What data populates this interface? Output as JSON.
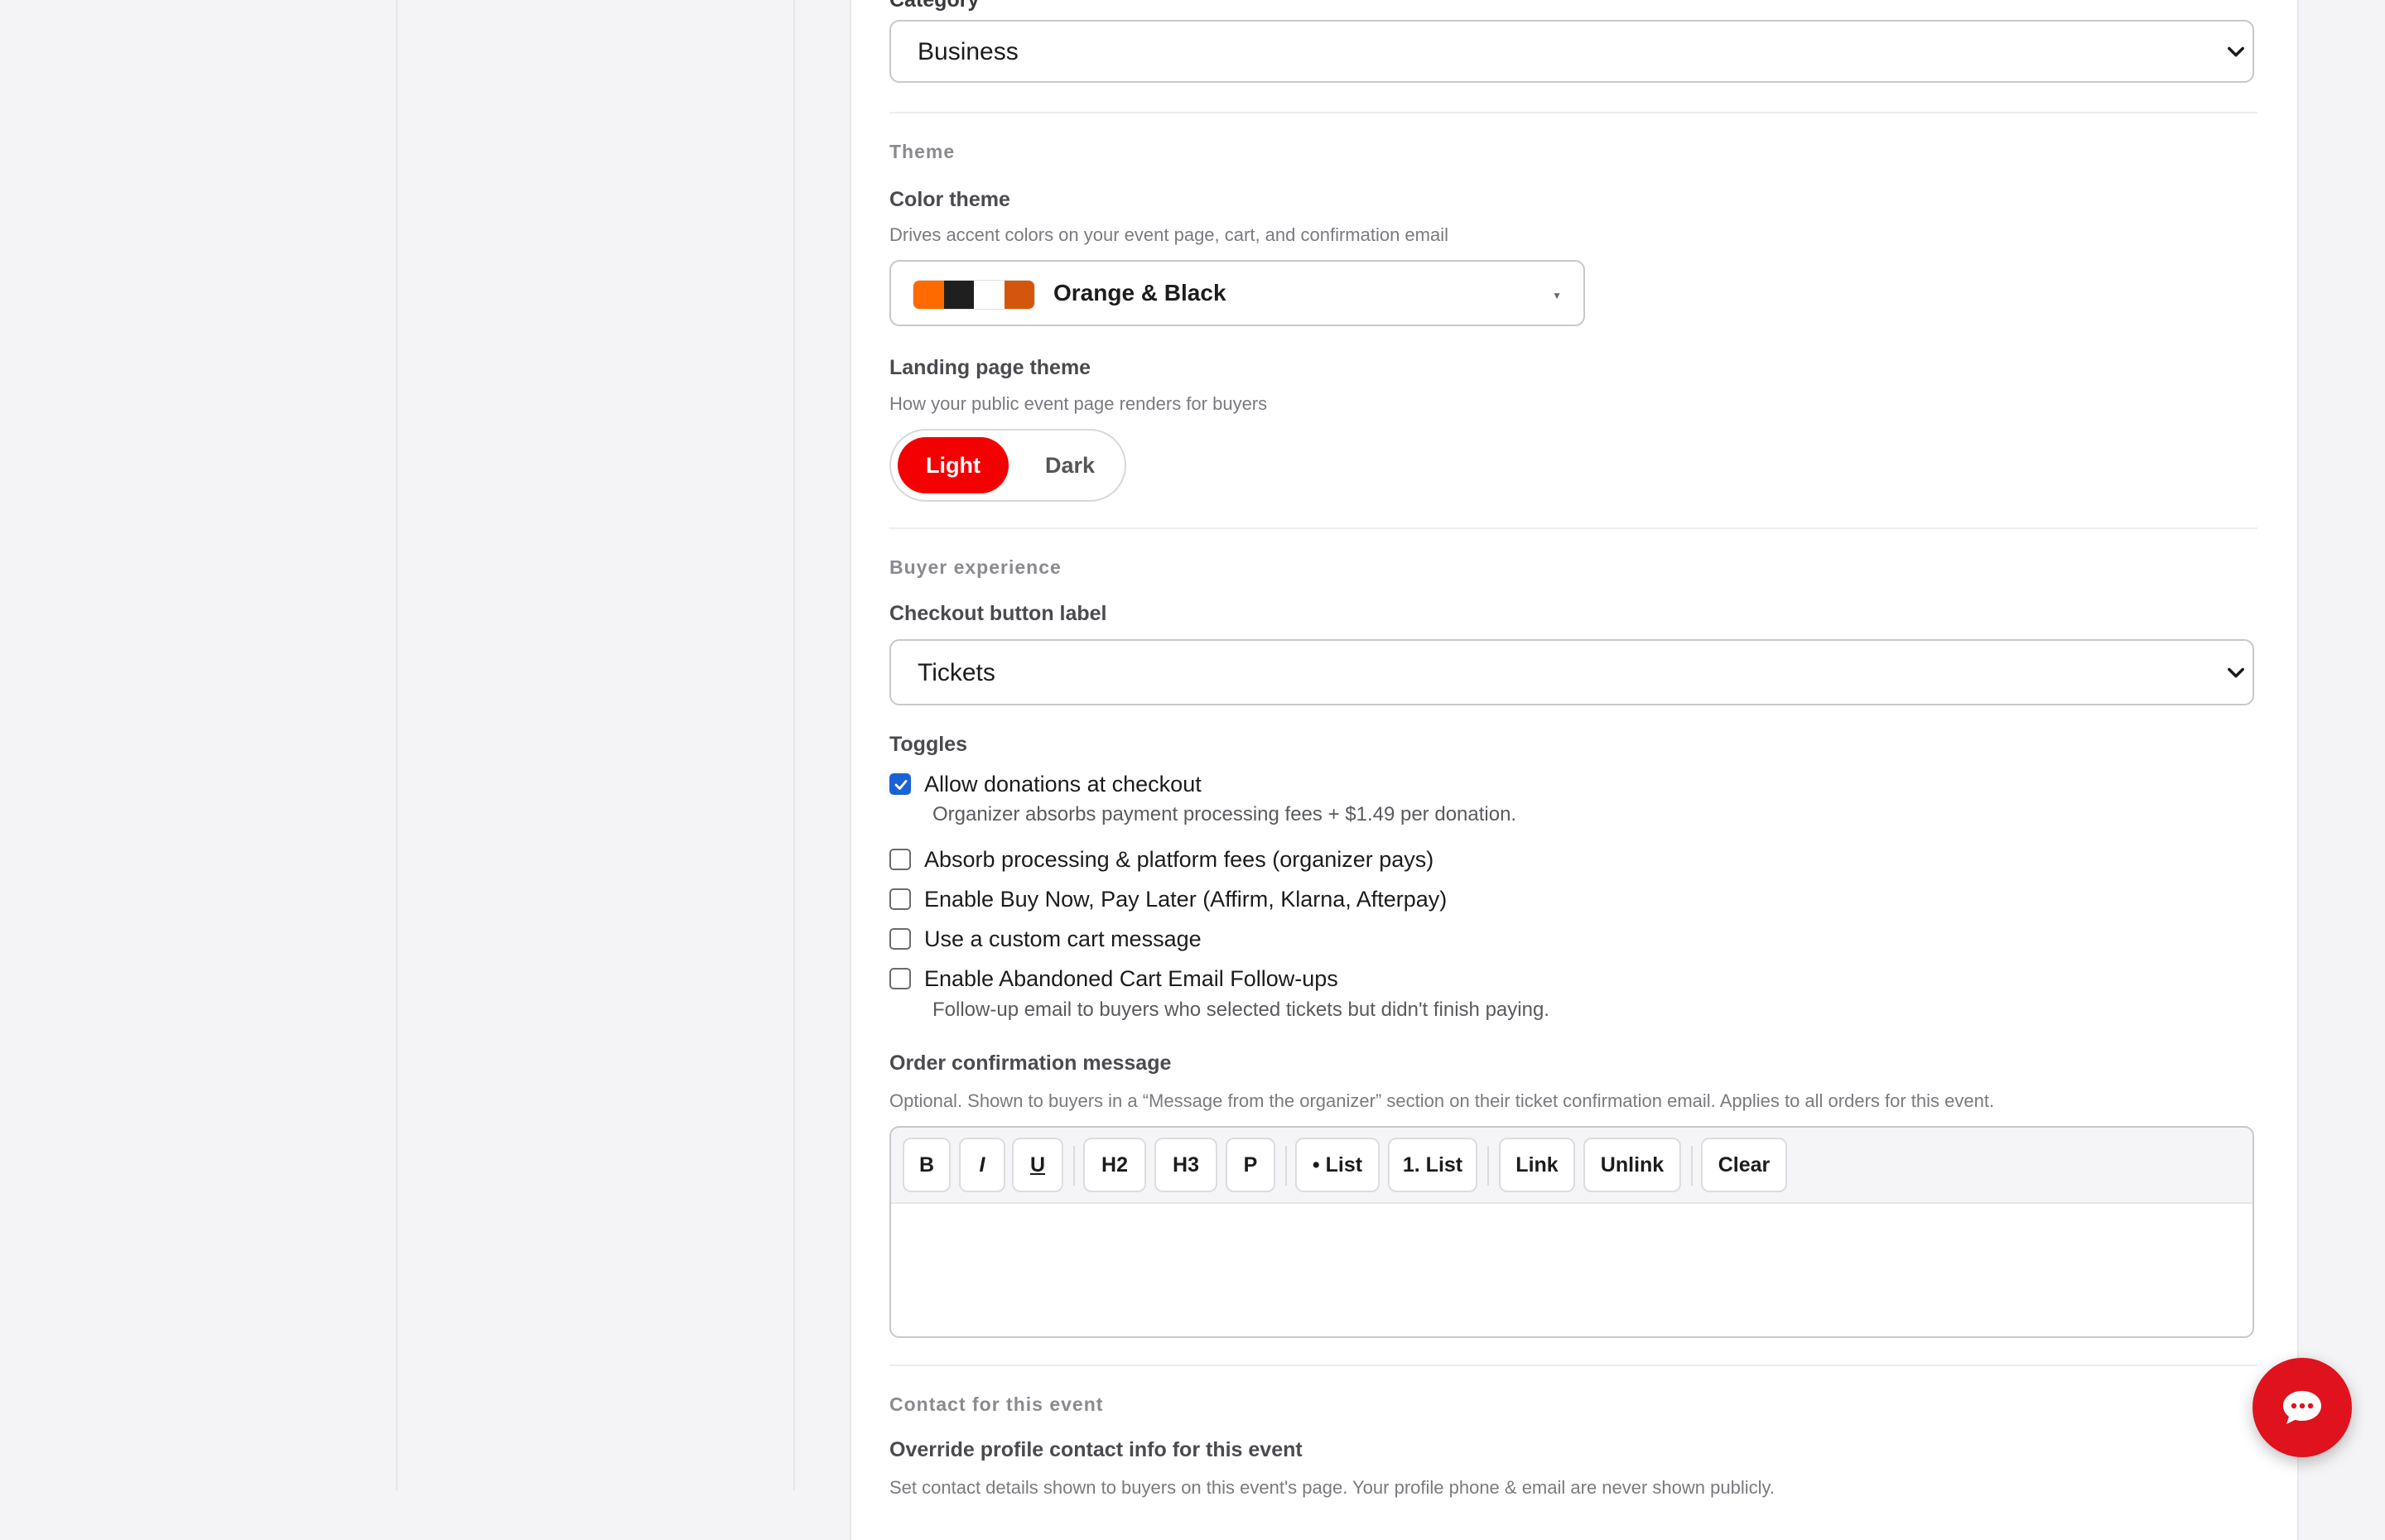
{
  "category": {
    "label": "Category",
    "value": "Business"
  },
  "theme": {
    "section_title": "Theme",
    "color_theme": {
      "label": "Color theme",
      "help": "Drives accent colors on your event page, cart, and confirmation email",
      "value": "Orange & Black",
      "swatches": [
        "#ff6a00",
        "#1f1f1f",
        "#ffffff",
        "#d4560a"
      ]
    },
    "landing": {
      "label": "Landing page theme",
      "help": "How your public event page renders for buyers",
      "options": [
        "Light",
        "Dark"
      ],
      "selected": "Light"
    }
  },
  "buyer": {
    "section_title": "Buyer experience",
    "checkout_label": {
      "label": "Checkout button label",
      "value": "Tickets"
    },
    "toggles_title": "Toggles",
    "toggles": [
      {
        "label": "Allow donations at checkout",
        "checked": true,
        "help": "Organizer absorbs payment processing fees + $1.49 per donation."
      },
      {
        "label": "Absorb processing & platform fees (organizer pays)",
        "checked": false
      },
      {
        "label": "Enable Buy Now, Pay Later (Affirm, Klarna, Afterpay)",
        "checked": false
      },
      {
        "label": "Use a custom cart message",
        "checked": false
      },
      {
        "label": "Enable Abandoned Cart Email Follow-ups",
        "checked": false,
        "help": "Follow-up email to buyers who selected tickets but didn't finish paying."
      }
    ]
  },
  "order_message": {
    "label": "Order confirmation message",
    "help": "Optional. Shown to buyers in a “Message from the organizer” section on their ticket confirmation email. Applies to all orders for this event.",
    "toolbar": {
      "bold": "B",
      "italic": "I",
      "underline": "U",
      "h2": "H2",
      "h3": "H3",
      "p": "P",
      "bullet": "• List",
      "numbered": "1. List",
      "link": "Link",
      "unlink": "Unlink",
      "clear": "Clear"
    }
  },
  "contact": {
    "section_title": "Contact for this event",
    "override_label": "Override profile contact info for this event",
    "help": "Set contact details shown to buyers on this event's page. Your profile phone & email are never shown publicly."
  },
  "colors": {
    "accent": "#f50000",
    "checkbox": "#1a63d6",
    "chat": "#e0121e"
  }
}
